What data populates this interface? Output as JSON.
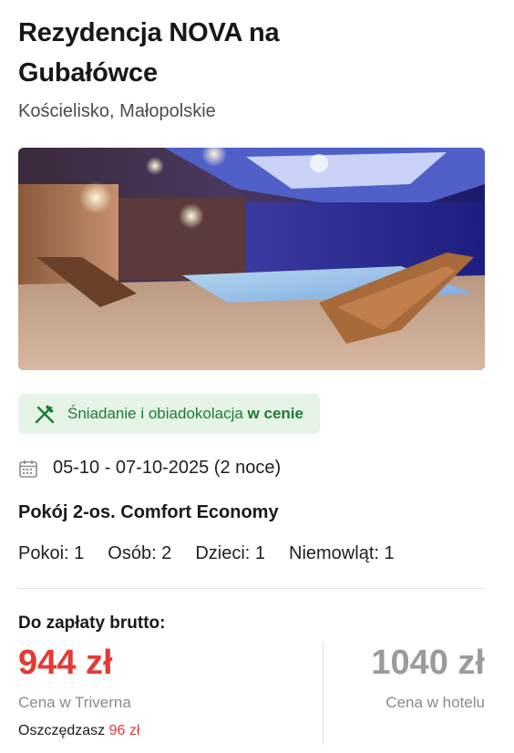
{
  "hotel": {
    "title_line1": "Rezydencja NOVA na",
    "title_line2": "Gubałówce",
    "location": "Kościelisko, Małopolskie"
  },
  "photo": {
    "icon": "pool-photo"
  },
  "meal": {
    "text": "Śniadanie i obiadokolacja ",
    "highlight": "w cenie",
    "icon": "fork-knife-icon",
    "color": "#1f7a32",
    "background": "#e6f4e8"
  },
  "stay": {
    "dates": "05-10 - 07-10-2025 (2 noce)",
    "icon": "calendar-icon"
  },
  "room": {
    "name": "Pokój 2-os. Comfort Economy",
    "rooms": "Pokoi: 1",
    "adults": "Osób: 2",
    "children": "Dzieci: 1",
    "infants": "Niemowląt: 1"
  },
  "pricing": {
    "label": "Do zapłaty brutto:",
    "price": "944 zł",
    "price_caption": "Cena w Triverna",
    "hotel_price": "1040 zł",
    "hotel_caption": "Cena w hotelu",
    "savings_label": "Oszczędzasz ",
    "savings_amount": "96 zł",
    "accent_color": "#e53935"
  }
}
